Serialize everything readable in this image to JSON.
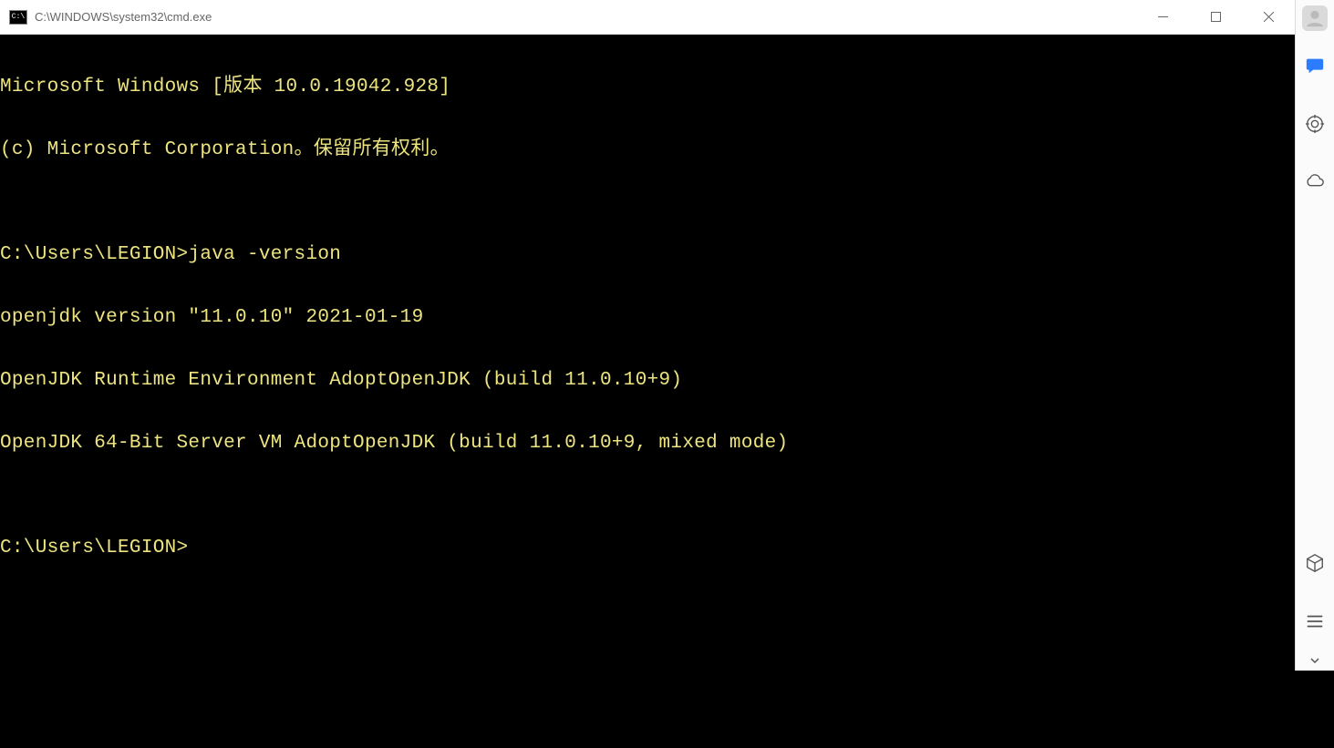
{
  "window": {
    "title": "C:\\WINDOWS\\system32\\cmd.exe",
    "icon_label": "C:\\"
  },
  "terminal": {
    "lines": [
      "Microsoft Windows [版本 10.0.19042.928]",
      "(c) Microsoft Corporation。保留所有权利。",
      "",
      "C:\\Users\\LEGION>java -version",
      "openjdk version \"11.0.10\" 2021-01-19",
      "OpenJDK Runtime Environment AdoptOpenJDK (build 11.0.10+9)",
      "OpenJDK 64-Bit Server VM AdoptOpenJDK (build 11.0.10+9, mixed mode)",
      "",
      "C:\\Users\\LEGION>"
    ]
  }
}
